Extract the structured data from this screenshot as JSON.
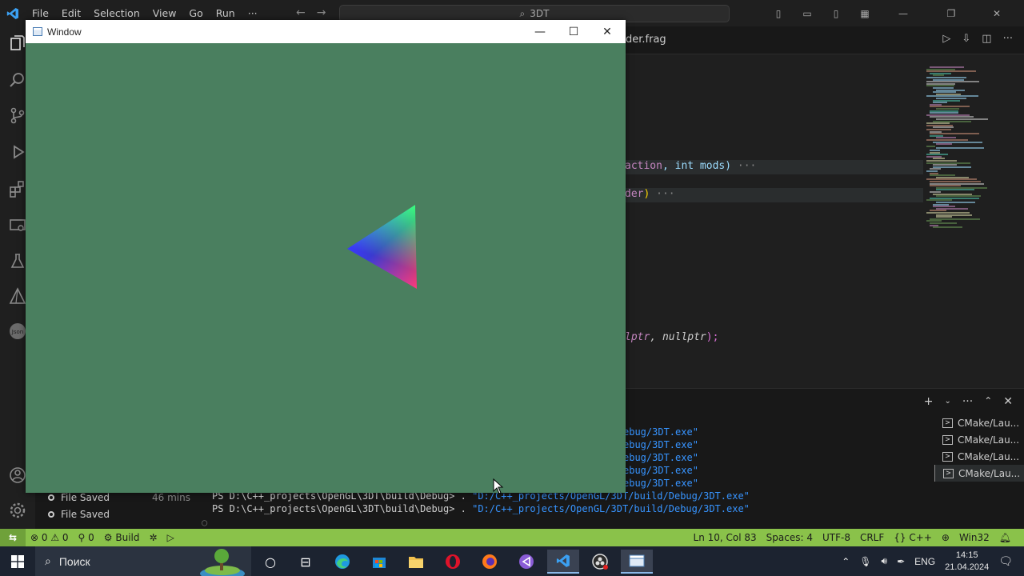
{
  "vscode": {
    "menu": [
      "File",
      "Edit",
      "Selection",
      "View",
      "Go",
      "Run",
      "···"
    ],
    "search_text": "3DT",
    "open_tab_partial": "der.frag",
    "code_fragments": {
      "line1_a": "action",
      "line1_b": ", int mods)",
      "line1_fold": "···",
      "line2_a": "der",
      "line2_b": ")",
      "line2_fold": "···",
      "line3_a": "lptr",
      "line3_b": ", nullptr",
      "line3_c": ");"
    },
    "terminal": {
      "prompt": "PS D:\\C++_projects\\OpenGL\\3DT\\build\\Debug> . ",
      "partial_path": "ebug/3DT.exe\"",
      "full_path": "\"D:/C++_projects/OpenGL/3DT/build/Debug/3DT.exe\"",
      "sessions": [
        "CMake/Lau...",
        "CMake/Lau...",
        "CMake/Lau...",
        "CMake/Lau..."
      ]
    },
    "timeline": [
      {
        "label": "File Saved",
        "time": "46 mins"
      },
      {
        "label": "File Saved",
        "time": ""
      }
    ],
    "statusbar": {
      "errors": "0",
      "warnings": "0",
      "ports": "0",
      "build": "Build",
      "position": "Ln 10, Col 83",
      "spaces": "Spaces: 4",
      "encoding": "UTF-8",
      "eol": "CRLF",
      "language": "C++",
      "platform": "Win32"
    }
  },
  "gl_window": {
    "title": "Window",
    "clear_color": "#4a7f5f"
  },
  "taskbar": {
    "search_label": "Поиск",
    "language": "ENG",
    "time": "14:15",
    "date": "21.04.2024"
  }
}
